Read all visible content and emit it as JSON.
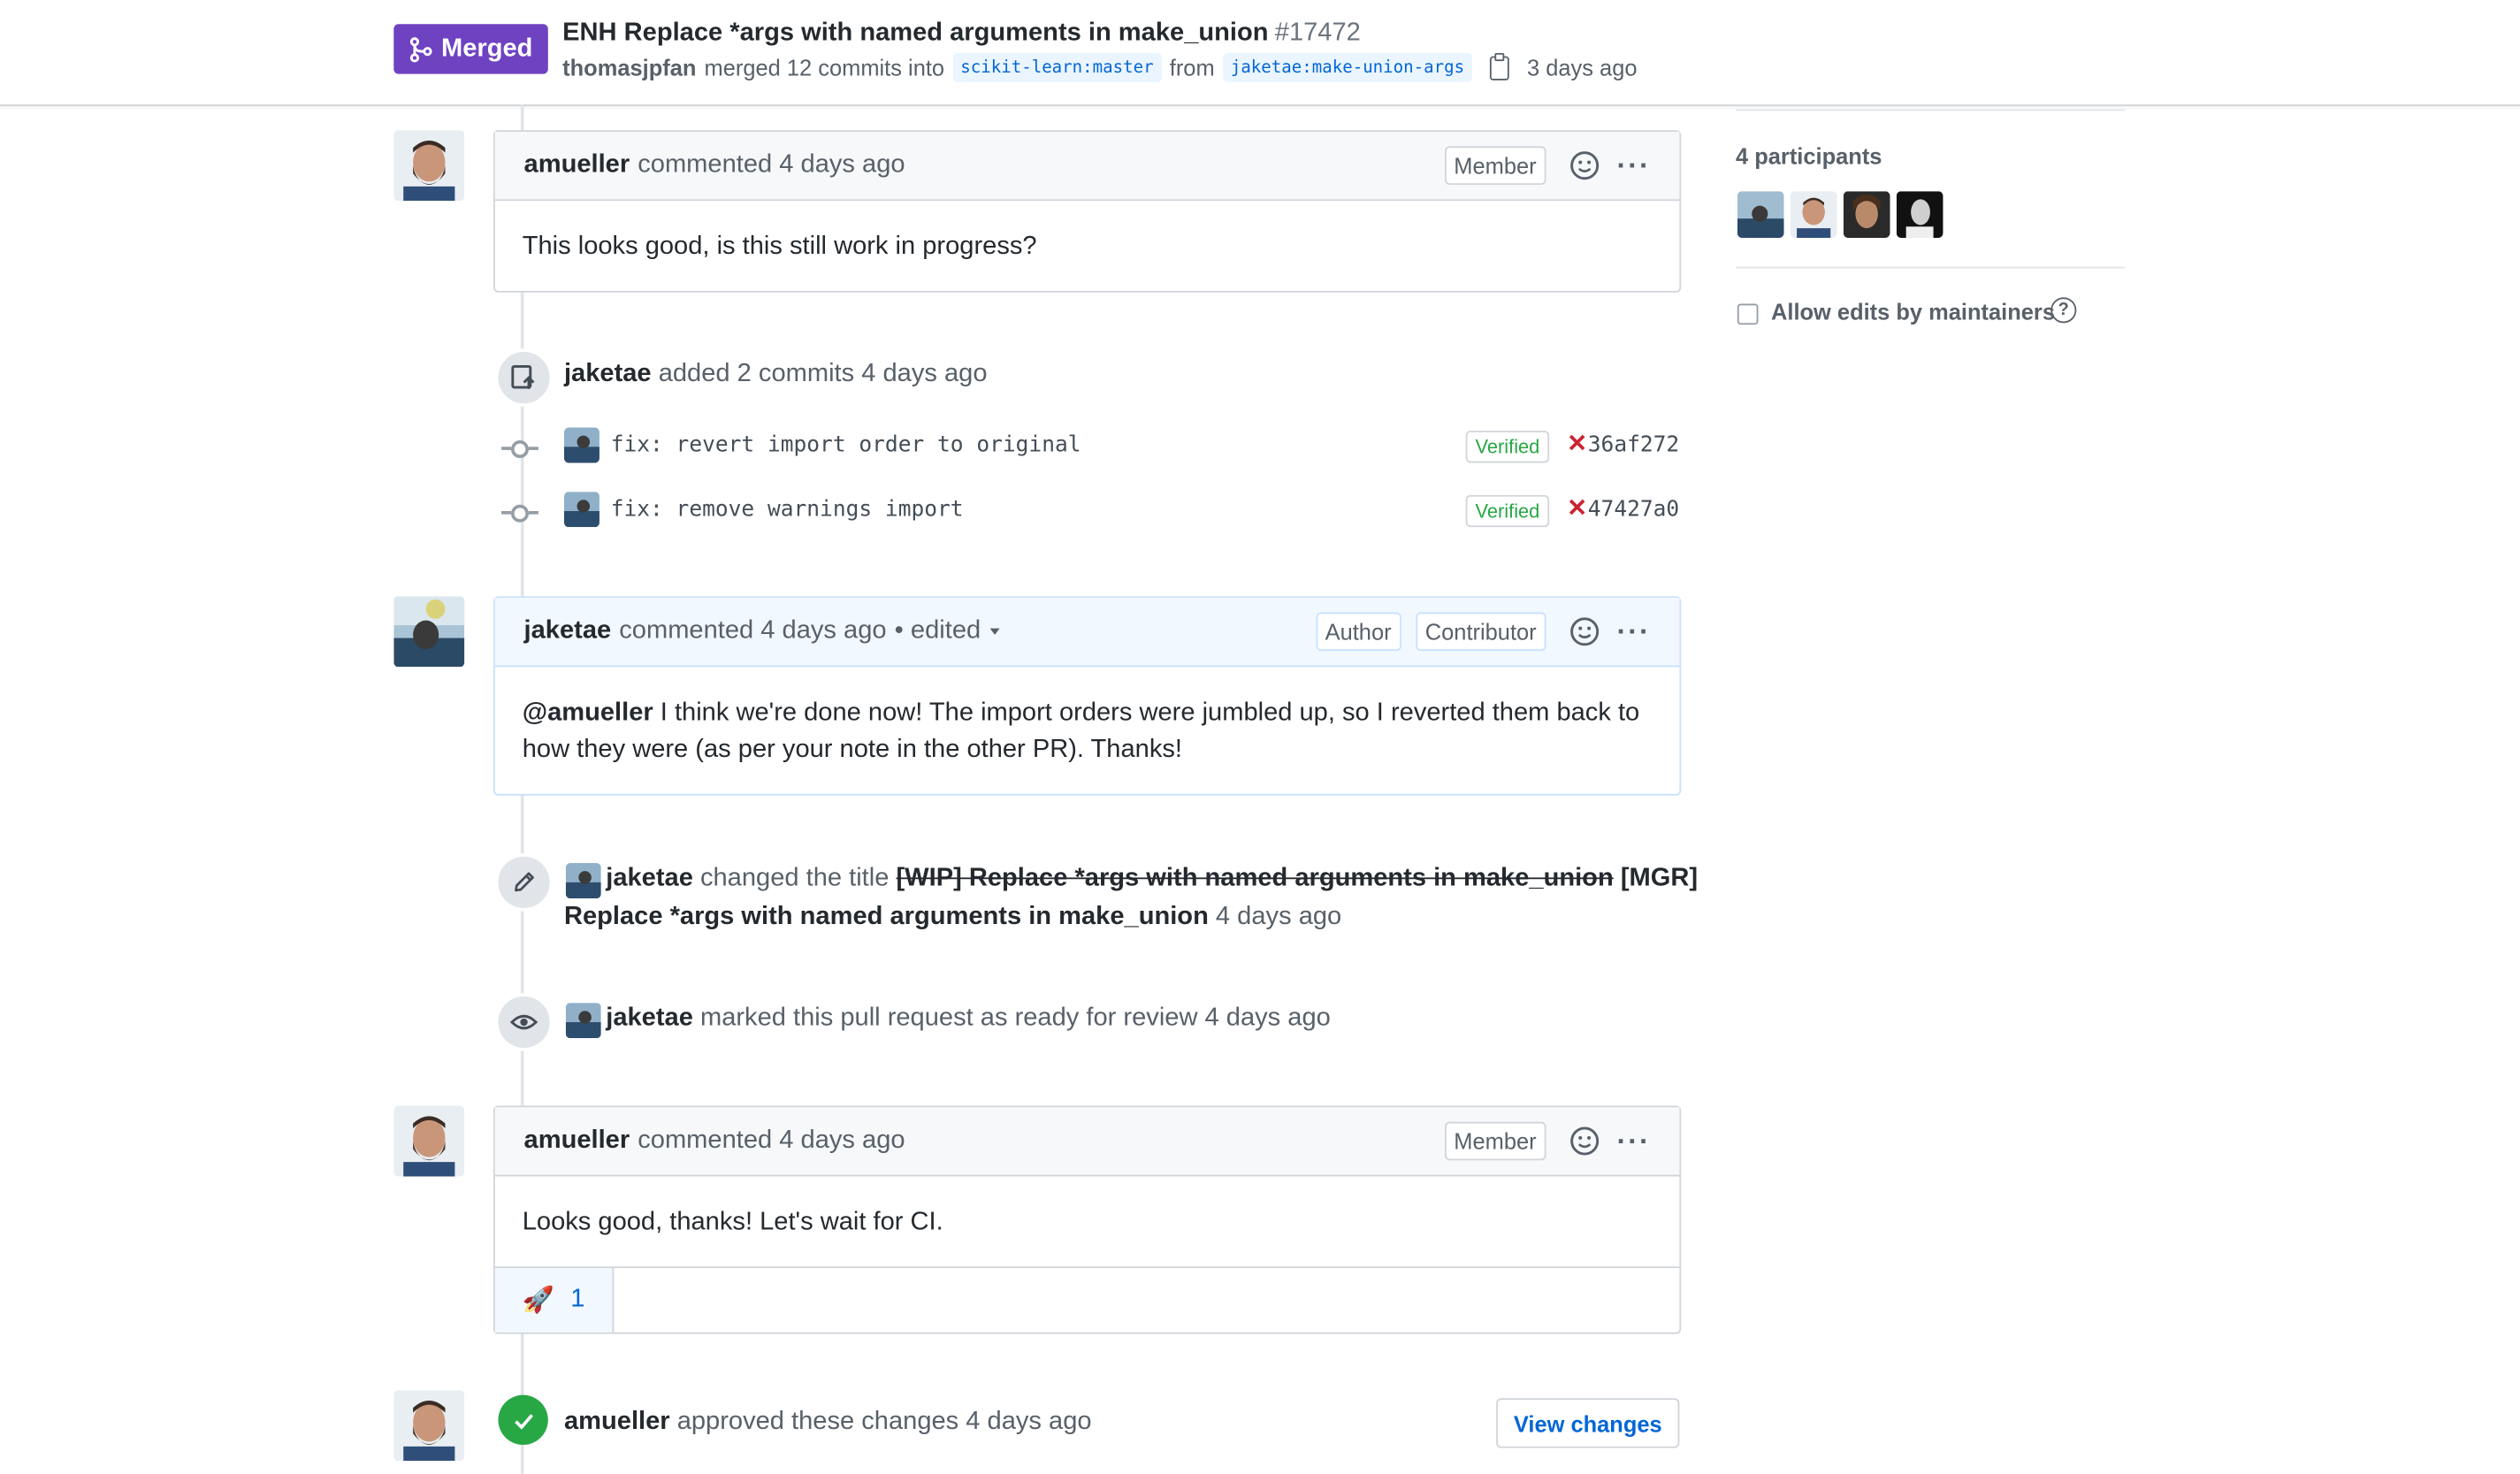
{
  "header": {
    "status": "Merged",
    "title": "ENH Replace *args with named arguments in make_union",
    "number": "#17472",
    "merger": "thomasjpfan",
    "merge_text": "merged 12 commits into",
    "base_branch": "scikit-learn:master",
    "from_text": "from",
    "head_branch": "jaketae:make-union-args",
    "time": "3 days ago"
  },
  "comment1": {
    "author": "amueller",
    "action": "commented 4 days ago",
    "label": "Member",
    "body": "This looks good, is this still work in progress?"
  },
  "commits_event": {
    "author": "jaketae",
    "text": "added 2 commits 4 days ago",
    "commits": [
      {
        "message": "fix: revert import order to original",
        "verified": "Verified",
        "sha": "36af272"
      },
      {
        "message": "fix: remove warnings import",
        "verified": "Verified",
        "sha": "47427a0"
      }
    ]
  },
  "comment2": {
    "author": "jaketae",
    "action": "commented 4 days ago",
    "edited": "• edited",
    "labels": [
      "Author",
      "Contributor"
    ],
    "mention": "@amueller",
    "body_line1": " I think we're done now! The import orders were jumbled up, so I reverted them back to",
    "body_line2": "how they were (as per your note in the other PR). Thanks!"
  },
  "title_event": {
    "author": "jaketae",
    "text": "changed the title",
    "old_title": "[WIP] Replace *args with named arguments in make_union",
    "new_title_part1": "[MGR]",
    "new_title_part2": "Replace *args with named arguments in make_union",
    "time": "4 days ago"
  },
  "ready_event": {
    "author": "jaketae",
    "text": "marked this pull request as ready for review 4 days ago"
  },
  "comment3": {
    "author": "amueller",
    "action": "commented 4 days ago",
    "label": "Member",
    "body": "Looks good, thanks! Let's wait for CI.",
    "reaction_emoji": "🚀",
    "reaction_count": "1"
  },
  "approve_event": {
    "author": "amueller",
    "text": "approved these changes 4 days ago",
    "button": "View changes"
  },
  "sidebar": {
    "participants_title": "4 participants",
    "allow_edits": "Allow edits by maintainers",
    "help_glyph": "?"
  },
  "colors": {
    "merged": "#6f42c1",
    "link": "#0366d6",
    "verified": "#28a745",
    "failed": "#cb2431",
    "approved": "#28a745"
  }
}
